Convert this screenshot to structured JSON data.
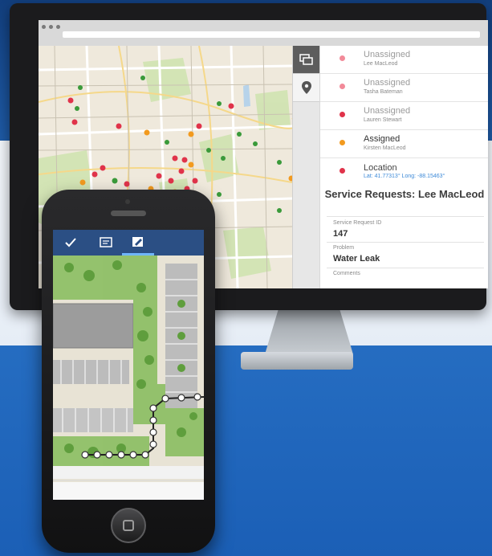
{
  "colors": {
    "unassigned": "#e0334a",
    "assigned": "#f29a1f",
    "accent": "#3d8ad8",
    "toolbar": "#2b4f84"
  },
  "requests": [
    {
      "status": "Unassigned",
      "name": "Lee MacLeod",
      "state": "unassigned"
    },
    {
      "status": "Unassigned",
      "name": "Tasha Bateman",
      "state": "unassigned"
    },
    {
      "status": "Unassigned",
      "name": "Lauren Stewart",
      "state": "unassigned"
    },
    {
      "status": "Assigned",
      "name": "Kirsten MacLeod",
      "state": "assigned"
    }
  ],
  "detail": {
    "location_label": "Location",
    "coords": "Lat: 41.77313° Long: -88.15463°",
    "title": "Service Requests: Lee MacLeod",
    "request_id_label": "Service Request ID",
    "request_id": "147",
    "problem_label": "Problem",
    "problem": "Water Leak",
    "comments_label": "Comments"
  },
  "map_tools": [
    {
      "icon": "basemap-gallery-icon"
    },
    {
      "icon": "location-pin-icon"
    }
  ],
  "phone": {
    "tabs": [
      {
        "icon": "checkmark-icon",
        "active": false
      },
      {
        "icon": "form-icon",
        "active": false
      },
      {
        "icon": "edit-form-icon",
        "active": true
      }
    ]
  }
}
